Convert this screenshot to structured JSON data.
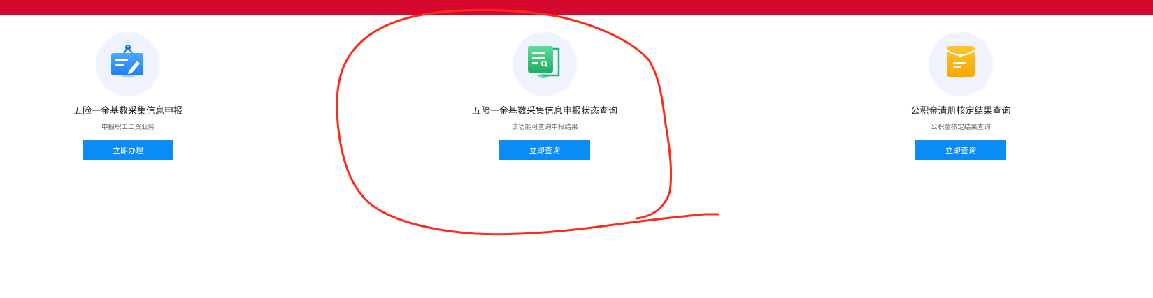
{
  "colors": {
    "top_bar": "#d5092e",
    "button": "#0a8cf7",
    "icon_bg": "#eef3fd",
    "annotation": "#ff2a1a"
  },
  "cards": [
    {
      "icon": "edit-document-icon",
      "title": "五险一金基数采集信息申报",
      "subtitle": "申报职工工资业务",
      "button_label": "立即办理"
    },
    {
      "icon": "search-document-icon",
      "title": "五险一金基数采集信息申报状态查询",
      "subtitle": "该功能可查询申报结果",
      "button_label": "立即查询"
    },
    {
      "icon": "envelope-icon",
      "title": "公积金清册核定结果查询",
      "subtitle": "公积金核定结果查询",
      "button_label": "立即查询"
    }
  ]
}
